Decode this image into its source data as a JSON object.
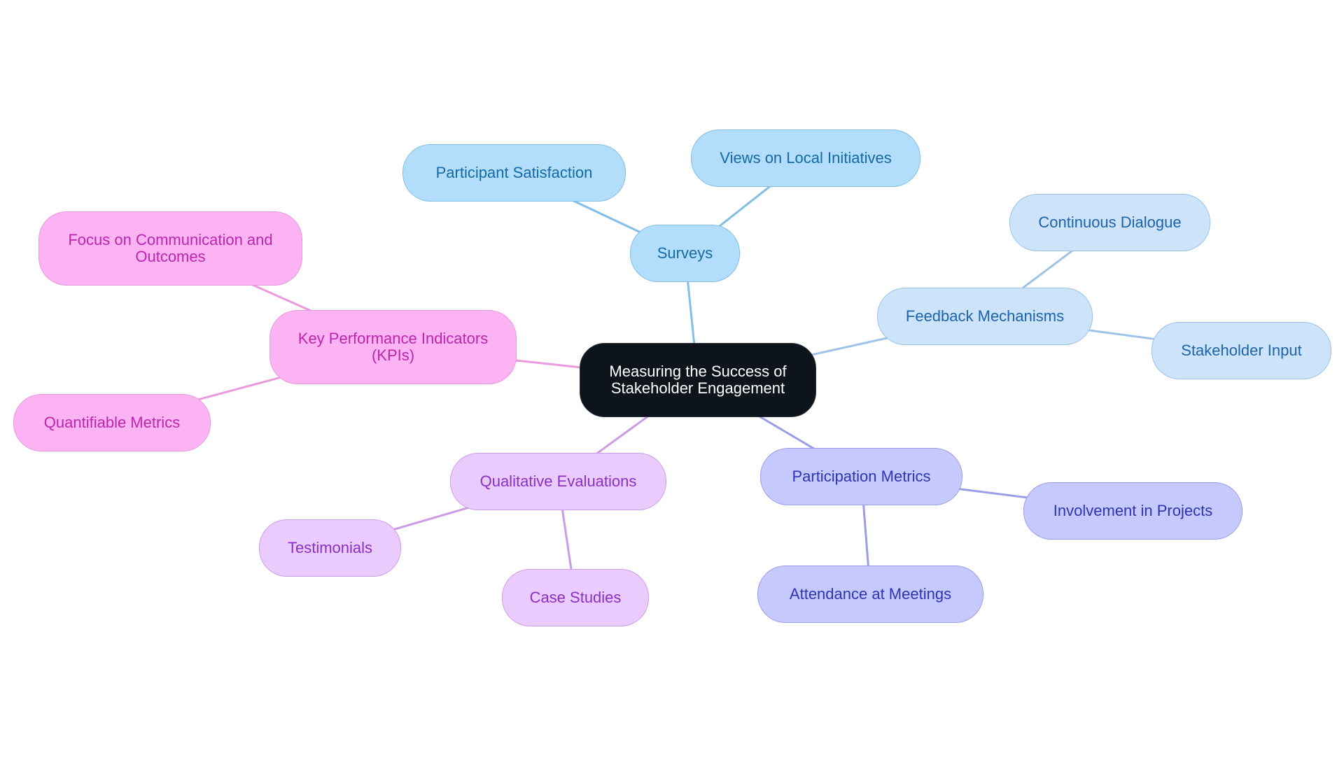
{
  "title": "Measuring the Success of Stakeholder Engagement",
  "colors": {
    "surveys_edge": "#83bee6",
    "feedback_edge": "#9fc3e8",
    "kpi_edge": "#eb9ade",
    "qual_edge": "#cc9be6",
    "part_edge": "#9a9ee6"
  },
  "nodes": {
    "root": "Measuring the Success of\nStakeholder Engagement",
    "surveys": "Surveys",
    "participant_satisfaction": "Participant Satisfaction",
    "views_local_initiatives": "Views on Local Initiatives",
    "feedback_mechanisms": "Feedback Mechanisms",
    "continuous_dialogue": "Continuous Dialogue",
    "stakeholder_input": "Stakeholder Input",
    "kpis": "Key Performance Indicators\n(KPIs)",
    "focus_communication": "Focus on Communication and\nOutcomes",
    "quantifiable_metrics": "Quantifiable Metrics",
    "qualitative_evaluations": "Qualitative Evaluations",
    "testimonials": "Testimonials",
    "case_studies": "Case Studies",
    "participation_metrics": "Participation Metrics",
    "involvement_projects": "Involvement in Projects",
    "attendance_meetings": "Attendance at Meetings"
  },
  "edges": [
    {
      "from": "root",
      "to": "surveys",
      "color": "surveys_edge"
    },
    {
      "from": "surveys",
      "to": "participant_satisfaction",
      "color": "surveys_edge"
    },
    {
      "from": "surveys",
      "to": "views_local_initiatives",
      "color": "surveys_edge"
    },
    {
      "from": "root",
      "to": "feedback_mechanisms",
      "color": "feedback_edge"
    },
    {
      "from": "feedback_mechanisms",
      "to": "continuous_dialogue",
      "color": "feedback_edge"
    },
    {
      "from": "feedback_mechanisms",
      "to": "stakeholder_input",
      "color": "feedback_edge"
    },
    {
      "from": "root",
      "to": "kpis",
      "color": "kpi_edge"
    },
    {
      "from": "kpis",
      "to": "focus_communication",
      "color": "kpi_edge"
    },
    {
      "from": "kpis",
      "to": "quantifiable_metrics",
      "color": "kpi_edge"
    },
    {
      "from": "root",
      "to": "qualitative_evaluations",
      "color": "qual_edge"
    },
    {
      "from": "qualitative_evaluations",
      "to": "testimonials",
      "color": "qual_edge"
    },
    {
      "from": "qualitative_evaluations",
      "to": "case_studies",
      "color": "qual_edge"
    },
    {
      "from": "root",
      "to": "participation_metrics",
      "color": "part_edge"
    },
    {
      "from": "participation_metrics",
      "to": "involvement_projects",
      "color": "part_edge"
    },
    {
      "from": "participation_metrics",
      "to": "attendance_meetings",
      "color": "part_edge"
    }
  ]
}
